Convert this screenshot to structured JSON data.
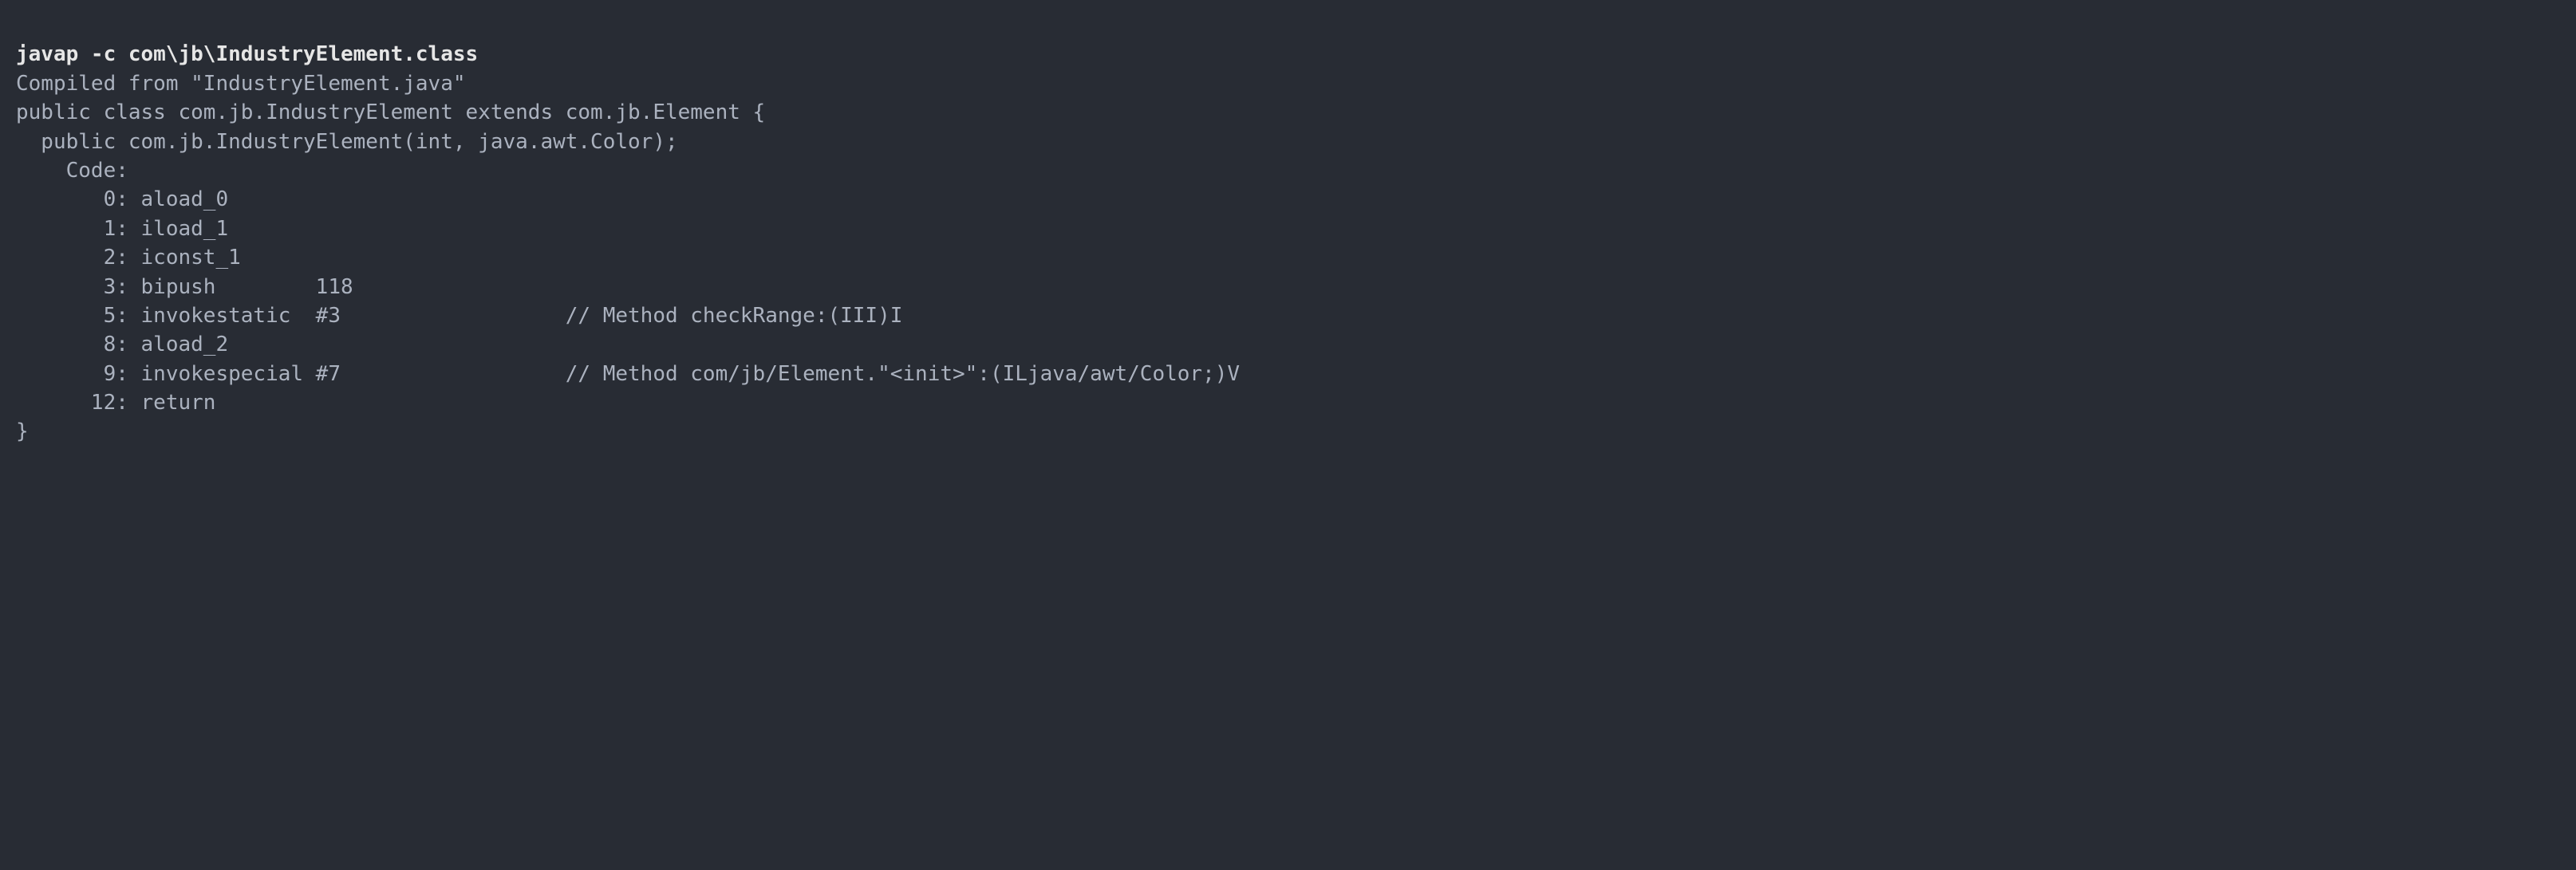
{
  "command": "javap -c com\\jb\\IndustryElement.class",
  "lines": [
    "Compiled from \"IndustryElement.java\"",
    "public class com.jb.IndustryElement extends com.jb.Element {",
    "  public com.jb.IndustryElement(int, java.awt.Color);",
    "    Code:",
    "       0: aload_0",
    "       1: iload_1",
    "       2: iconst_1",
    "       3: bipush        118",
    "       5: invokestatic  #3                  // Method checkRange:(III)I",
    "       8: aload_2",
    "       9: invokespecial #7                  // Method com/jb/Element.\"<init>\":(ILjava/awt/Color;)V",
    "      12: return",
    "}"
  ]
}
